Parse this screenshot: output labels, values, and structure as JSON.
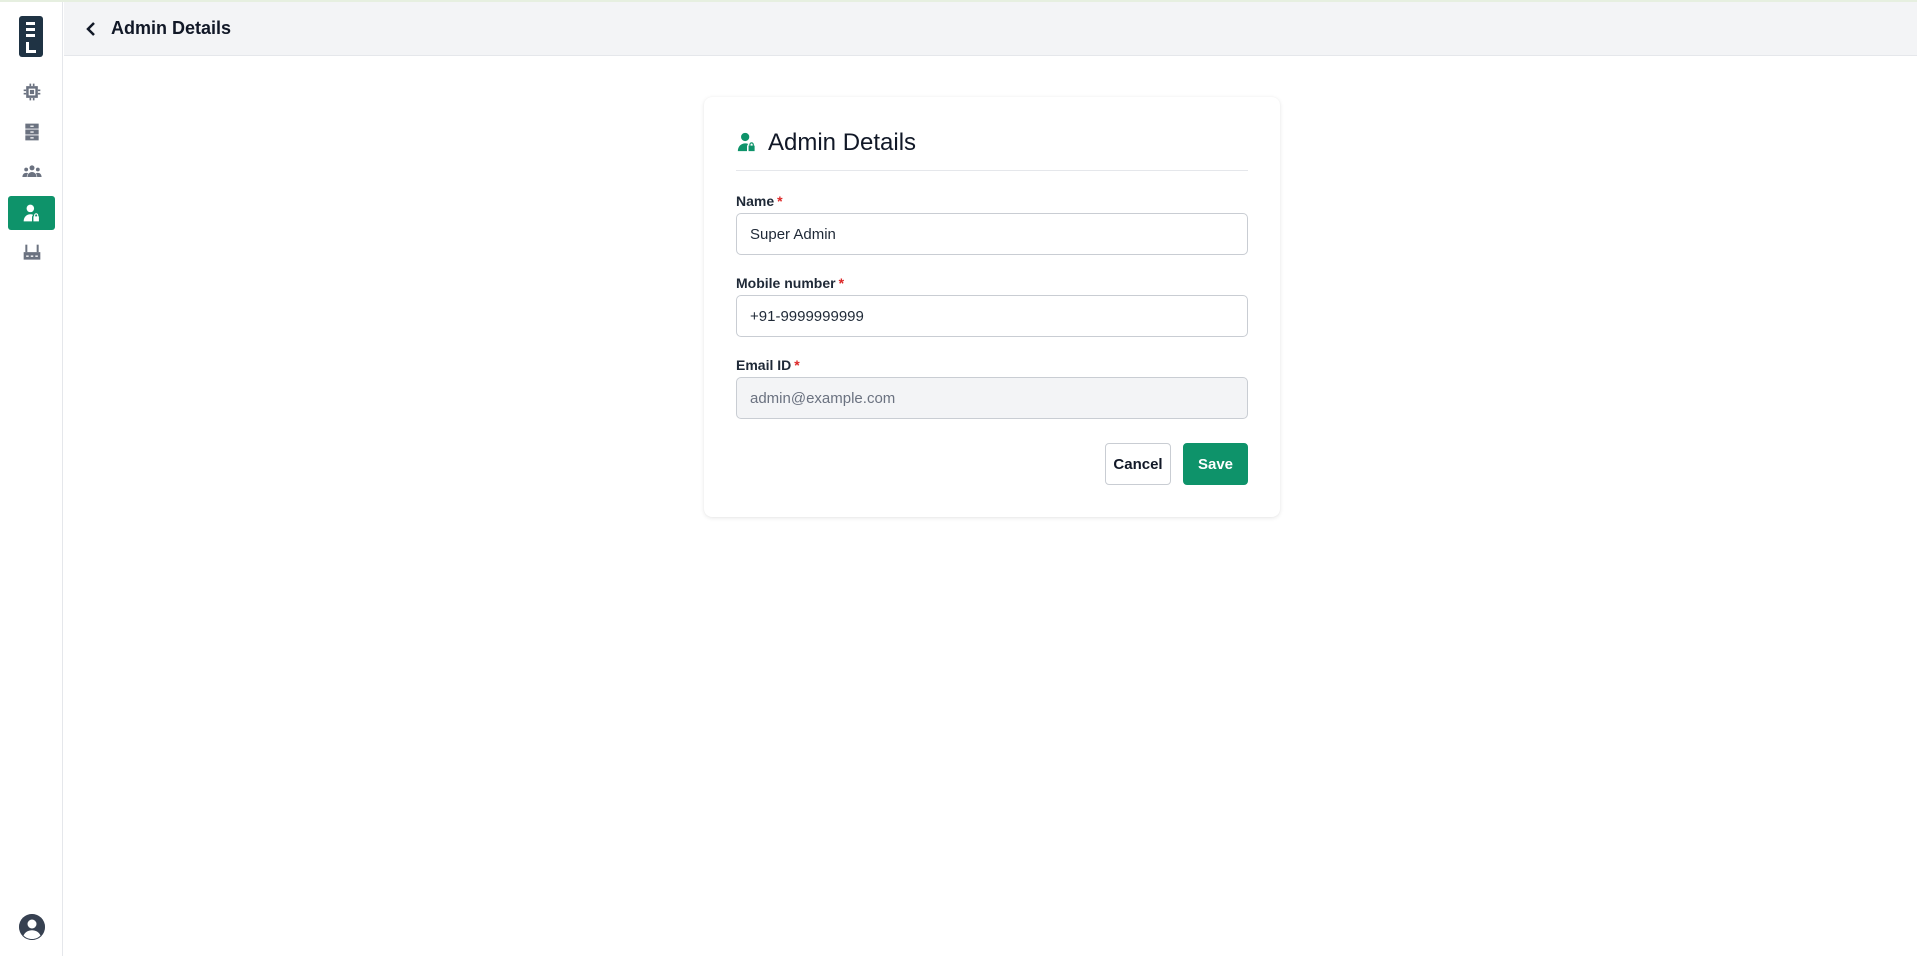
{
  "header": {
    "title": "Admin Details",
    "back_icon": "chevron-left-icon"
  },
  "sidebar": {
    "items": [
      {
        "icon": "chip-icon",
        "active": false
      },
      {
        "icon": "server-icon",
        "active": false
      },
      {
        "icon": "users-icon",
        "active": false
      },
      {
        "icon": "admin-user-icon",
        "active": true
      },
      {
        "icon": "gateway-icon",
        "active": false
      }
    ],
    "avatar_icon": "account-circle-icon"
  },
  "card": {
    "title": "Admin Details",
    "title_icon": "admin-user-icon",
    "fields": {
      "name": {
        "label": "Name",
        "required_mark": "*",
        "value": "Super Admin"
      },
      "mobile": {
        "label": "Mobile number",
        "required_mark": "*",
        "value": "+91-9999999999"
      },
      "email": {
        "label": "Email ID",
        "required_mark": "*",
        "value": "admin@example.com",
        "disabled": true
      }
    },
    "actions": {
      "cancel_label": "Cancel",
      "save_label": "Save"
    }
  },
  "colors": {
    "accent": "#0e936a",
    "required": "#dc2626",
    "header_bg": "#f3f4f6",
    "logo_bg": "#1f3344"
  }
}
